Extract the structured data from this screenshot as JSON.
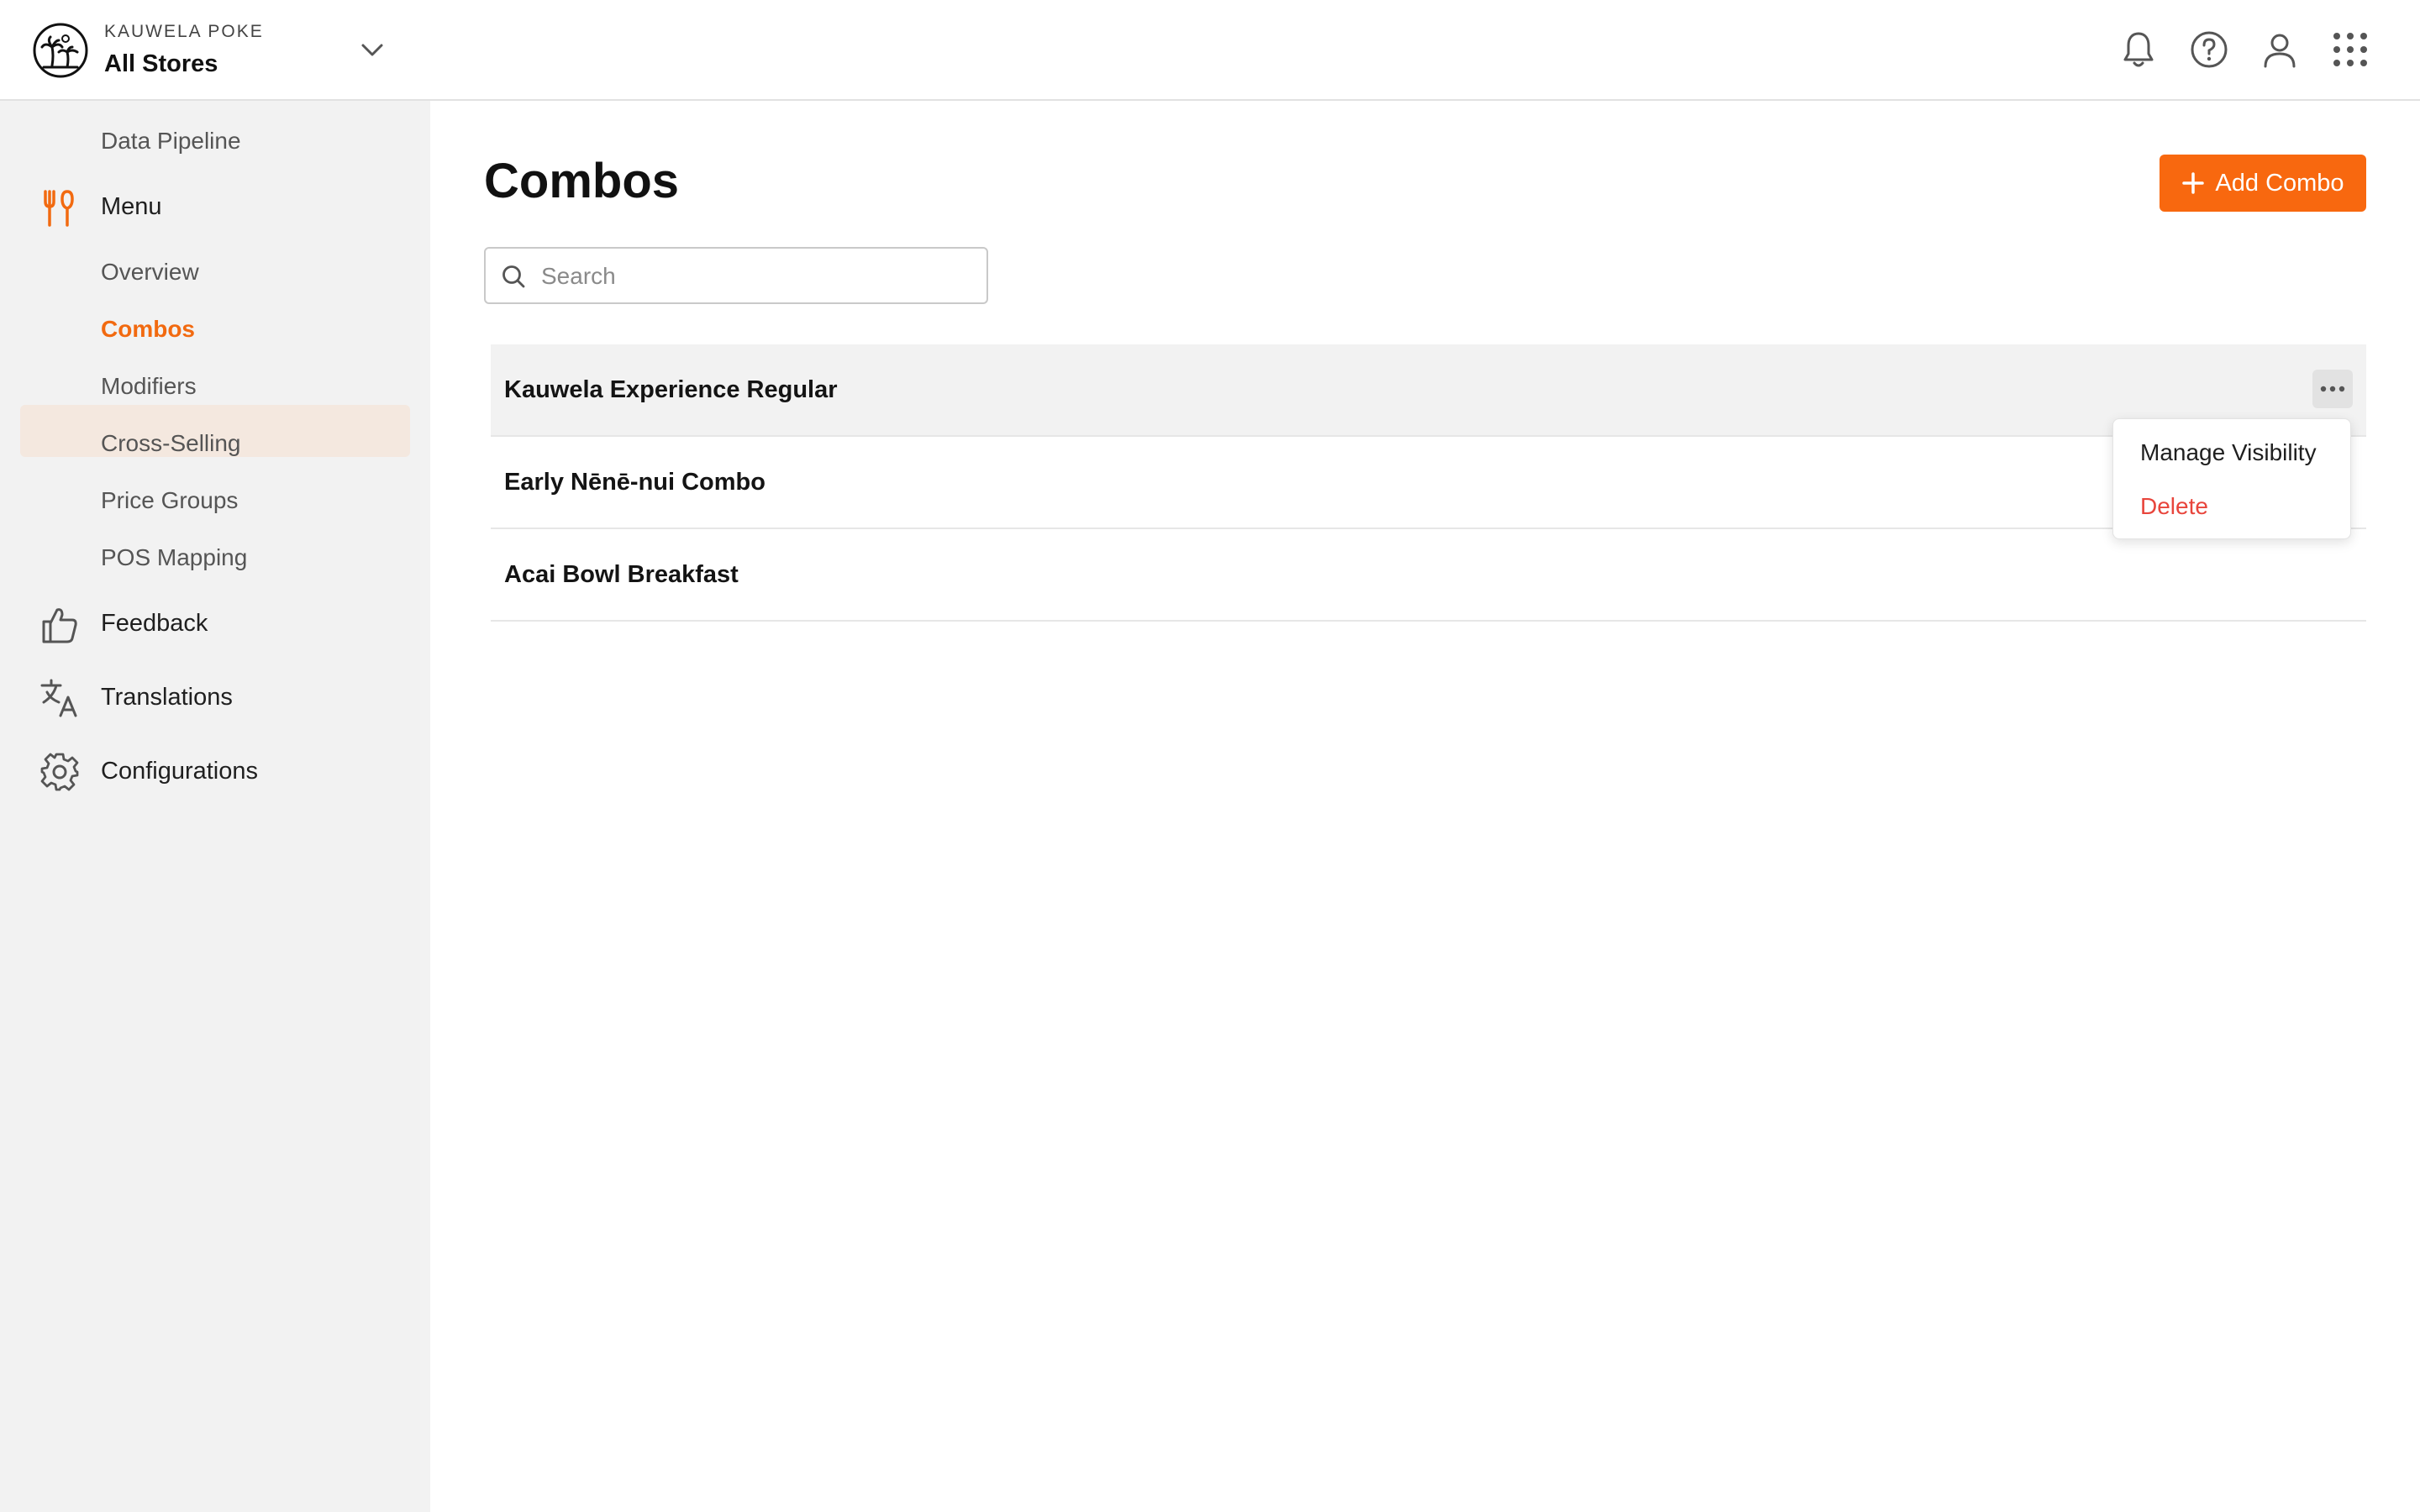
{
  "header": {
    "org": "KAUWELA POKE",
    "store": "All Stores"
  },
  "sidebar": {
    "items": [
      {
        "label": "Data Pipeline",
        "type": "sub"
      },
      {
        "label": "Menu",
        "type": "main",
        "icon": "fork-knife-icon"
      },
      {
        "label": "Overview",
        "type": "sub"
      },
      {
        "label": "Combos",
        "type": "sub",
        "active": true
      },
      {
        "label": "Modifiers",
        "type": "sub"
      },
      {
        "label": "Cross-Selling",
        "type": "sub"
      },
      {
        "label": "Price Groups",
        "type": "sub"
      },
      {
        "label": "POS Mapping",
        "type": "sub"
      },
      {
        "label": "Feedback",
        "type": "main",
        "icon": "thumbs-up-icon"
      },
      {
        "label": "Translations",
        "type": "main",
        "icon": "translate-icon"
      },
      {
        "label": "Configurations",
        "type": "main",
        "icon": "gear-icon"
      }
    ]
  },
  "main": {
    "title": "Combos",
    "add_button": "Add Combo",
    "search_placeholder": "Search",
    "combos": [
      {
        "name": "Kauwela Experience Regular"
      },
      {
        "name": "Early Nēnē-nui Combo"
      },
      {
        "name": "Acai Bowl Breakfast"
      }
    ],
    "row_menu": {
      "manage": "Manage Visibility",
      "delete": "Delete"
    }
  },
  "colors": {
    "accent": "#f8680f",
    "danger": "#e8453c",
    "active_bg": "#f4e8df",
    "sidebar_bg": "#f2f2f2"
  }
}
